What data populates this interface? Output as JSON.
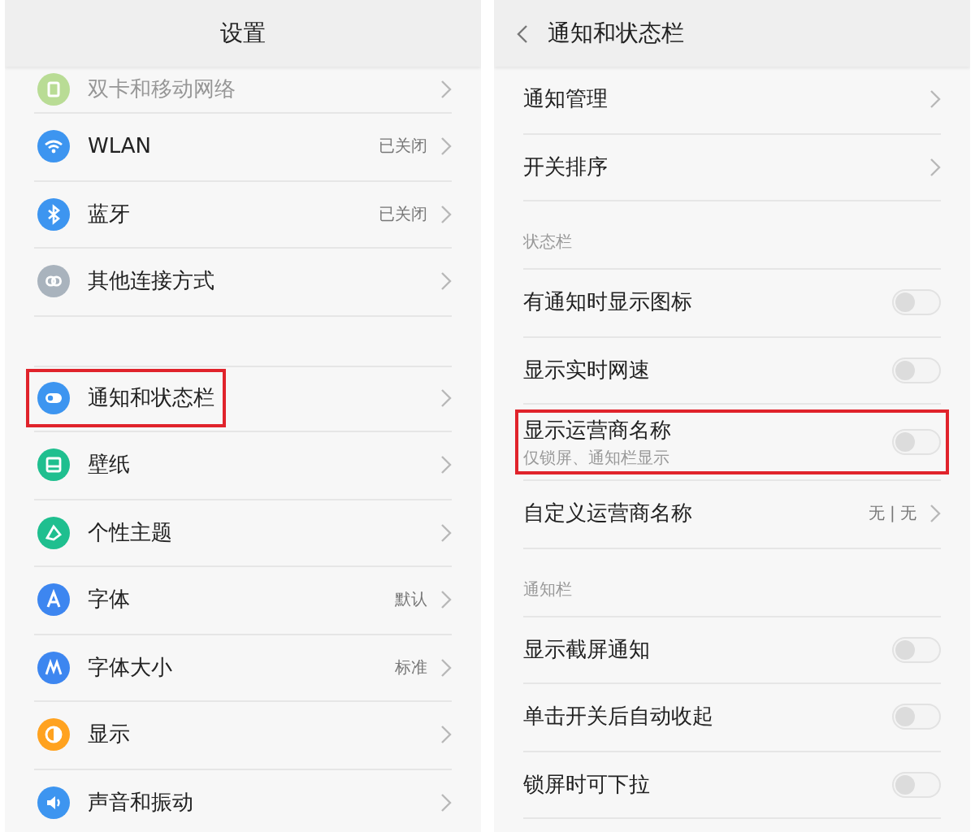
{
  "settings": {
    "title": "设置",
    "sections": [
      {
        "items": [
          {
            "label": "双卡和移动网络",
            "color": "#b9dc95",
            "faded": true,
            "highlighted": false
          },
          {
            "label": "WLAN",
            "value": "已关闭",
            "color": "#3d95f0",
            "faded": false,
            "highlighted": false
          },
          {
            "label": "蓝牙",
            "value": "已关闭",
            "color": "#3d95f0",
            "faded": false,
            "highlighted": false
          },
          {
            "label": "其他连接方式",
            "color": "#a9b3bd",
            "faded": false,
            "highlighted": false
          }
        ]
      },
      {
        "items": [
          {
            "label": "通知和状态栏",
            "color": "#3d95f0",
            "faded": false,
            "highlighted": true
          },
          {
            "label": "壁纸",
            "color": "#1fbf8f",
            "faded": false,
            "highlighted": false
          },
          {
            "label": "个性主题",
            "color": "#1fbf8f",
            "faded": false,
            "highlighted": false
          },
          {
            "label": "字体",
            "value": "默认",
            "color": "#3d86f0",
            "faded": false,
            "highlighted": false
          },
          {
            "label": "字体大小",
            "value": "标准",
            "color": "#3d86f0",
            "faded": false,
            "highlighted": false
          },
          {
            "label": "显示",
            "color": "#ffa21f",
            "faded": false,
            "highlighted": false
          },
          {
            "label": "声音和振动",
            "color": "#3d95f0",
            "faded": false,
            "highlighted": false
          }
        ]
      }
    ]
  },
  "notifications": {
    "title": "通知和状态栏",
    "groups": [
      {
        "items": [
          {
            "kind": "link",
            "label": "通知管理",
            "highlighted": false
          },
          {
            "kind": "link",
            "label": "开关排序",
            "highlighted": false
          }
        ]
      },
      {
        "header": "状态栏",
        "items": [
          {
            "kind": "switch",
            "label": "有通知时显示图标",
            "on": false,
            "highlighted": false
          },
          {
            "kind": "switch",
            "label": "显示实时网速",
            "on": false,
            "highlighted": false
          },
          {
            "kind": "switch",
            "label": "显示运营商名称",
            "sublabel": "仅锁屏、通知栏显示",
            "on": false,
            "highlighted": true
          },
          {
            "kind": "link",
            "label": "自定义运营商名称",
            "value": "无 | 无",
            "highlighted": false
          }
        ]
      },
      {
        "header": "通知栏",
        "items": [
          {
            "kind": "switch",
            "label": "显示截屏通知",
            "on": false,
            "highlighted": false
          },
          {
            "kind": "switch",
            "label": "单击开关后自动收起",
            "on": false,
            "highlighted": false
          },
          {
            "kind": "switch",
            "label": "锁屏时可下拉",
            "on": false,
            "highlighted": false
          }
        ]
      }
    ]
  }
}
